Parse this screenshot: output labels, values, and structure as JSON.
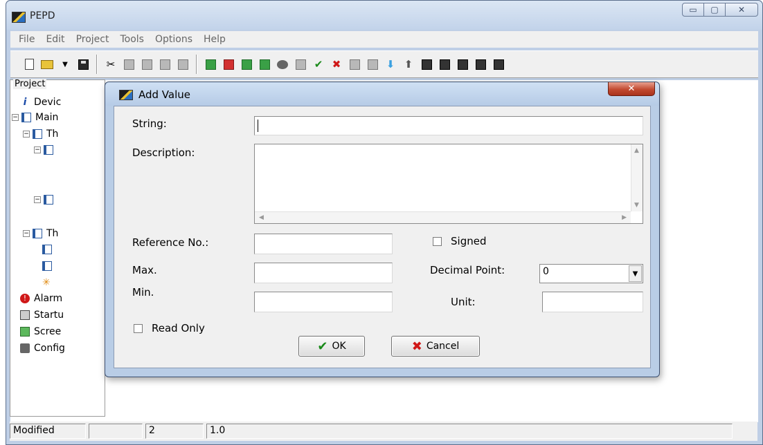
{
  "window": {
    "title": "PEPD",
    "controls": {
      "minimize": "▭",
      "maximize": "▢",
      "close": "✕"
    }
  },
  "menu": [
    "File",
    "Edit",
    "Project",
    "Tools",
    "Options",
    "Help"
  ],
  "project_panel": {
    "title": "Project",
    "items": [
      "Devic",
      "Main",
      "Th",
      "Th",
      "Alarm",
      "Startu",
      "Scree",
      "Config"
    ]
  },
  "status_bar": {
    "state": "Modified",
    "blank": "",
    "field2": "2",
    "field3": "1.0"
  },
  "dialog": {
    "title": "Add Value",
    "close_glyph": "✕",
    "string_label": "String:",
    "string_value": "",
    "description_label": "Description:",
    "description_value": "",
    "reference_label": "Reference No.:",
    "reference_value": "",
    "signed_label": "Signed",
    "max_label": "Max.",
    "max_value": "",
    "min_label": "Min.",
    "min_value": "",
    "decimal_label": "Decimal Point:",
    "decimal_value": "0",
    "unit_label": "Unit:",
    "unit_value": "",
    "read_only_label": "Read Only",
    "ok_label": "OK",
    "cancel_label": "Cancel"
  },
  "colors": {
    "accent_blue": "#bfcfe6",
    "close_red": "#c24a30",
    "ok_green": "#1a8a1a",
    "cancel_red": "#d01818"
  }
}
